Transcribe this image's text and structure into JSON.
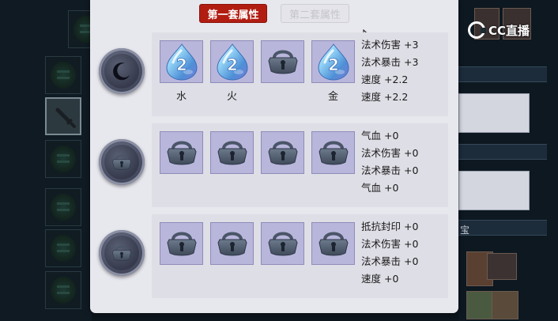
{
  "tabs": [
    {
      "label": "第一套属性",
      "active": true
    },
    {
      "label": "第二套属性",
      "active": false
    }
  ],
  "watermark": "CC直播",
  "background_text": "宝",
  "sets": [
    {
      "disc_icon": "crescent-moon-icon",
      "slots": [
        {
          "icon": "water-drop-gem-icon",
          "level": "2",
          "label": "水"
        },
        {
          "icon": "water-drop-gem-icon",
          "level": "2",
          "label": "火"
        },
        {
          "icon": "empty-padlock-icon",
          "label": ""
        },
        {
          "icon": "water-drop-gem-icon",
          "level": "2",
          "label": "金"
        }
      ],
      "stats": [
        "法术伤害 +3",
        "法术暴击 +3",
        "速度 +2.2",
        "速度 +2.2"
      ]
    },
    {
      "disc_icon": "padlock-icon",
      "slots": [
        {
          "icon": "empty-padlock-icon",
          "label": ""
        },
        {
          "icon": "empty-padlock-icon",
          "label": ""
        },
        {
          "icon": "empty-padlock-icon",
          "label": ""
        },
        {
          "icon": "empty-padlock-icon",
          "label": ""
        }
      ],
      "stats": [
        "气血 +0",
        "法术伤害 +0",
        "法术暴击 +0",
        "气血 +0"
      ]
    },
    {
      "disc_icon": "padlock-icon",
      "slots": [
        {
          "icon": "empty-padlock-icon",
          "label": ""
        },
        {
          "icon": "empty-padlock-icon",
          "label": ""
        },
        {
          "icon": "empty-padlock-icon",
          "label": ""
        },
        {
          "icon": "empty-padlock-icon",
          "label": ""
        }
      ],
      "stats": [
        "抵抗封印 +0",
        "法术伤害 +0",
        "法术暴击 +0",
        "速度 +0"
      ]
    }
  ],
  "colors": {
    "tab_active_bg": "#b21d12",
    "slot_bg": "#b9b6dc",
    "dialog_bg": "#e7e7ee",
    "row_bg": "#dedee6"
  }
}
